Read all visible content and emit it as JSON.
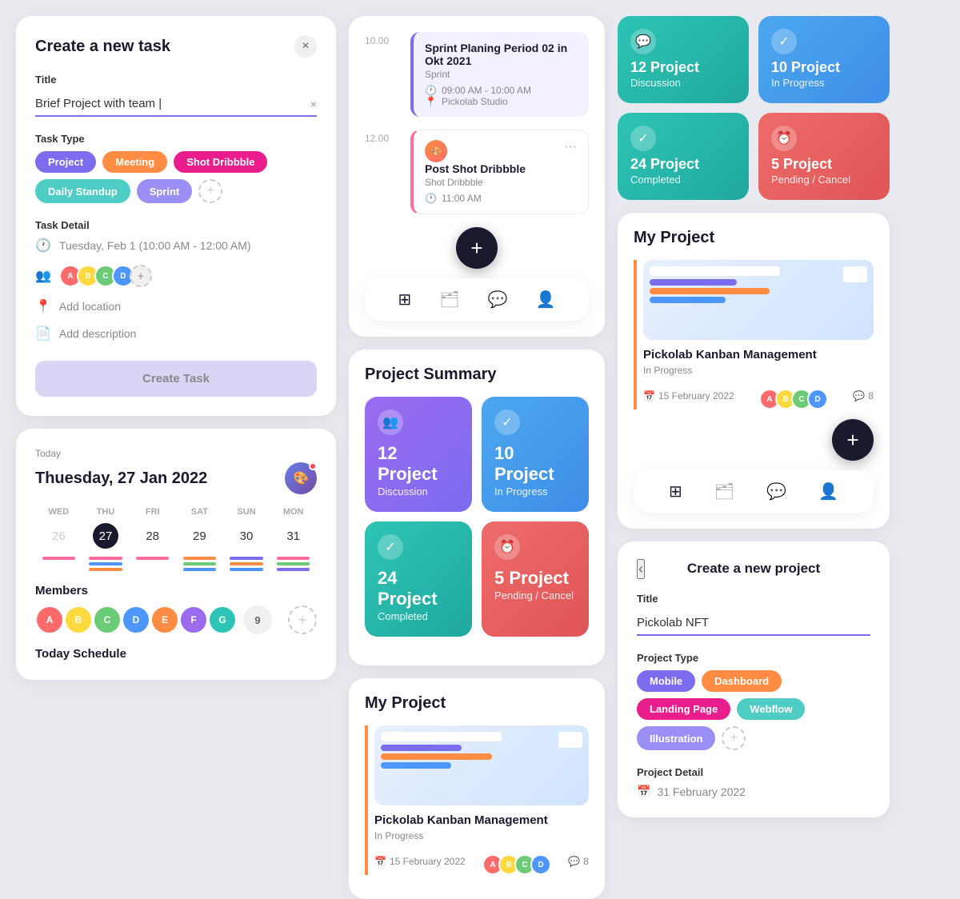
{
  "colors": {
    "primary": "#7c6cf0",
    "dark": "#1a1a2e",
    "teal": "#2ec4b6",
    "blue": "#4da8ef",
    "red": "#ef6b6b",
    "orange": "#ff8c42",
    "pink": "#ff6b9d",
    "green": "#6bcb77"
  },
  "col1": {
    "createTask": {
      "title": "Create a new task",
      "closeLabel": "×",
      "fieldTitle": "Title",
      "inputValue": "Brief Project with team |",
      "clearLabel": "×",
      "taskTypeLabel": "Task Type",
      "tags": [
        {
          "label": "Project",
          "style": "blue"
        },
        {
          "label": "Meeting",
          "style": "orange"
        },
        {
          "label": "Shot Dribbble",
          "style": "pink"
        },
        {
          "label": "Daily Standup",
          "style": "green"
        },
        {
          "label": "Sprint",
          "style": "purple"
        }
      ],
      "taskDetailLabel": "Task Detail",
      "dateValue": "Tuesday, Feb 1 (10:00 AM - 12:00 AM)",
      "locationPlaceholder": "Add location",
      "descPlaceholder": "Add description",
      "createBtnLabel": "Create Task"
    },
    "calendar": {
      "todayLabel": "Today",
      "dateTitle": "Thuesday, 27 Jan 2022",
      "days": [
        "WED",
        "THU",
        "FRI",
        "SAT",
        "SUN",
        "MON"
      ],
      "dates": [
        "26",
        "27",
        "28",
        "29",
        "30",
        "31"
      ],
      "todayIndex": 1,
      "membersLabel": "Members",
      "memberCount": "9",
      "todayScheduleLabel": "Today Schedule"
    }
  },
  "col2": {
    "schedule": {
      "slots": [
        {
          "time": "10.00",
          "event": {
            "title": "Sprint Planing Period 02 in Okt 2021",
            "subtitle": "Sprint",
            "timeRange": "09:00 AM - 10:00 AM",
            "location": "Pickolab Studio",
            "type": "purple"
          }
        },
        {
          "time": "12.00",
          "event": {
            "title": "Post Shot Dribbble",
            "subtitle": "Shot Dribbble",
            "timeRange": "11:00 AM",
            "type": "white"
          }
        }
      ],
      "fabLabel": "+"
    },
    "projectSummary": {
      "title": "Project Summary",
      "cards": [
        {
          "number": "12",
          "label": "Project Discussion",
          "icon": "👥",
          "style": "purple"
        },
        {
          "number": "10",
          "label": "Project In Progress",
          "icon": "✓",
          "style": "blue"
        },
        {
          "number": "24",
          "label": "Project Completed",
          "icon": "✓",
          "style": "teal"
        },
        {
          "number": "5",
          "label": "Project Pending / Cancel",
          "icon": "⏰",
          "style": "red"
        }
      ]
    },
    "myProject": {
      "title": "My Project",
      "project": {
        "name": "Pickolab Kanban Management",
        "status": "In Progress",
        "date": "15 February 2022",
        "comments": "8"
      }
    }
  },
  "col3": {
    "topCards": [
      {
        "number": "12",
        "label": "Project Discussion",
        "icon": "💬",
        "style": "teal"
      },
      {
        "number": "10",
        "label": "Project In Progress",
        "icon": "✓",
        "style": "blue"
      },
      {
        "number": "24",
        "label": "Project Completed",
        "icon": "✓",
        "style": "green"
      },
      {
        "number": "5",
        "label": "Project Pending / Cancel",
        "icon": "⏰",
        "style": "red"
      }
    ],
    "myProject": {
      "title": "My Project",
      "project": {
        "name": "Pickolab Kanban Management",
        "status": "In Progress",
        "date": "15 February 2022",
        "comments": "8"
      }
    },
    "createProject": {
      "backLabel": "‹",
      "title": "Create a new project",
      "titleFieldLabel": "Title",
      "titleValue": "Pickolab NFT",
      "projectTypeLabel": "Project Type",
      "tags": [
        {
          "label": "Mobile",
          "style": "blue"
        },
        {
          "label": "Dashboard",
          "style": "orange"
        },
        {
          "label": "Landing Page",
          "style": "pink"
        },
        {
          "label": "Webflow",
          "style": "green"
        },
        {
          "label": "Illustration",
          "style": "purple"
        }
      ],
      "projectDetailLabel": "Project Detail",
      "dateValue": "31 February 2022"
    }
  },
  "nav": {
    "items": [
      "⊞",
      "🗂",
      "💬",
      "👤"
    ]
  }
}
